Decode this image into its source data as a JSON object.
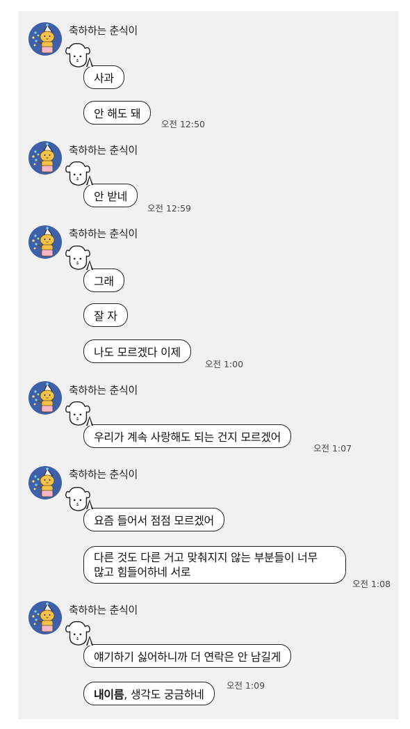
{
  "sender": "축하하는 춘식이",
  "groups": [
    {
      "messages": [
        "사과",
        "안 해도 돼"
      ],
      "time": "오전 12:50"
    },
    {
      "messages": [
        "안 받네"
      ],
      "time": "오전 12:59"
    },
    {
      "messages": [
        "그래",
        "잘 자",
        "나도 모르겠다 이제"
      ],
      "time": "오전 1:00"
    },
    {
      "messages": [
        "우리가 계속 사랑해도 되는 건지 모르겠어"
      ],
      "time": "오전 1:07"
    },
    {
      "messages": [
        "요즘 들어서 점점 모르겠어",
        "다른 것도 다른 거고 맞춰지지 않는 부분들이 너무",
        "많고 힘들어하네 서로"
      ],
      "time": "오전 1:08"
    },
    {
      "messages": [
        "얘기하기 싫어하니까 더 연락은 안 남길게",
        "내이름",
        ", 생각도 궁금하네"
      ],
      "time": "오전 1:09"
    }
  ],
  "icons": {
    "avatar": "choonsik-party-avatar-icon",
    "dog": "dog-face-icon"
  },
  "colors": {
    "background": "#f1f1f1",
    "bubble": "#ffffff",
    "outline": "#222222",
    "avatar_bg": "#3f5fa8",
    "avatar_char": "#f5c24a"
  }
}
